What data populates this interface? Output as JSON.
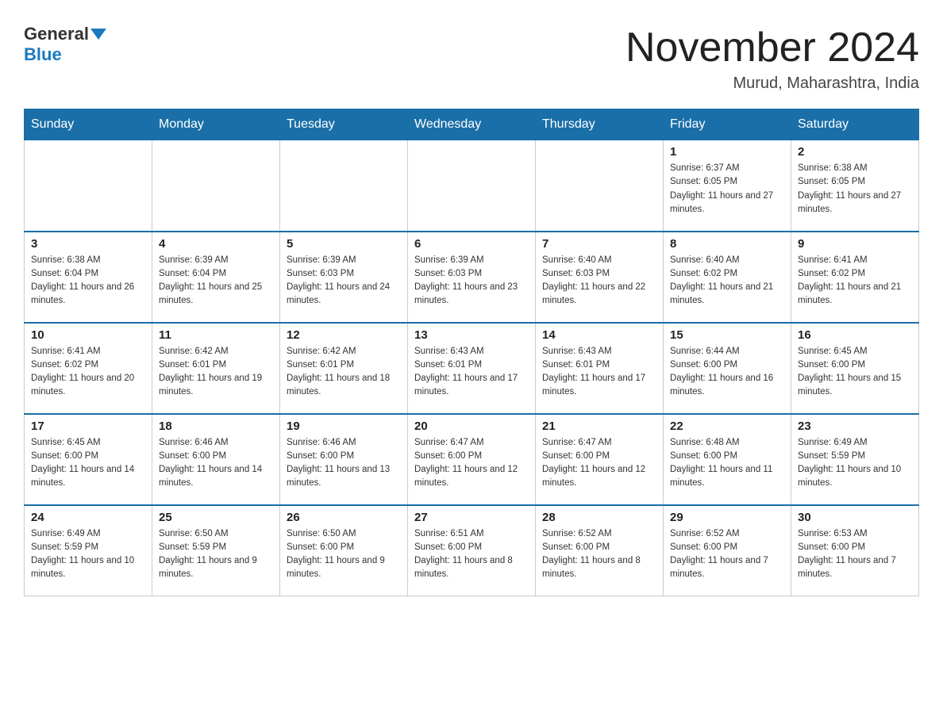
{
  "logo": {
    "general": "General",
    "blue": "Blue"
  },
  "title": "November 2024",
  "location": "Murud, Maharashtra, India",
  "days_of_week": [
    "Sunday",
    "Monday",
    "Tuesday",
    "Wednesday",
    "Thursday",
    "Friday",
    "Saturday"
  ],
  "weeks": [
    [
      {
        "day": "",
        "info": ""
      },
      {
        "day": "",
        "info": ""
      },
      {
        "day": "",
        "info": ""
      },
      {
        "day": "",
        "info": ""
      },
      {
        "day": "",
        "info": ""
      },
      {
        "day": "1",
        "info": "Sunrise: 6:37 AM\nSunset: 6:05 PM\nDaylight: 11 hours and 27 minutes."
      },
      {
        "day": "2",
        "info": "Sunrise: 6:38 AM\nSunset: 6:05 PM\nDaylight: 11 hours and 27 minutes."
      }
    ],
    [
      {
        "day": "3",
        "info": "Sunrise: 6:38 AM\nSunset: 6:04 PM\nDaylight: 11 hours and 26 minutes."
      },
      {
        "day": "4",
        "info": "Sunrise: 6:39 AM\nSunset: 6:04 PM\nDaylight: 11 hours and 25 minutes."
      },
      {
        "day": "5",
        "info": "Sunrise: 6:39 AM\nSunset: 6:03 PM\nDaylight: 11 hours and 24 minutes."
      },
      {
        "day": "6",
        "info": "Sunrise: 6:39 AM\nSunset: 6:03 PM\nDaylight: 11 hours and 23 minutes."
      },
      {
        "day": "7",
        "info": "Sunrise: 6:40 AM\nSunset: 6:03 PM\nDaylight: 11 hours and 22 minutes."
      },
      {
        "day": "8",
        "info": "Sunrise: 6:40 AM\nSunset: 6:02 PM\nDaylight: 11 hours and 21 minutes."
      },
      {
        "day": "9",
        "info": "Sunrise: 6:41 AM\nSunset: 6:02 PM\nDaylight: 11 hours and 21 minutes."
      }
    ],
    [
      {
        "day": "10",
        "info": "Sunrise: 6:41 AM\nSunset: 6:02 PM\nDaylight: 11 hours and 20 minutes."
      },
      {
        "day": "11",
        "info": "Sunrise: 6:42 AM\nSunset: 6:01 PM\nDaylight: 11 hours and 19 minutes."
      },
      {
        "day": "12",
        "info": "Sunrise: 6:42 AM\nSunset: 6:01 PM\nDaylight: 11 hours and 18 minutes."
      },
      {
        "day": "13",
        "info": "Sunrise: 6:43 AM\nSunset: 6:01 PM\nDaylight: 11 hours and 17 minutes."
      },
      {
        "day": "14",
        "info": "Sunrise: 6:43 AM\nSunset: 6:01 PM\nDaylight: 11 hours and 17 minutes."
      },
      {
        "day": "15",
        "info": "Sunrise: 6:44 AM\nSunset: 6:00 PM\nDaylight: 11 hours and 16 minutes."
      },
      {
        "day": "16",
        "info": "Sunrise: 6:45 AM\nSunset: 6:00 PM\nDaylight: 11 hours and 15 minutes."
      }
    ],
    [
      {
        "day": "17",
        "info": "Sunrise: 6:45 AM\nSunset: 6:00 PM\nDaylight: 11 hours and 14 minutes."
      },
      {
        "day": "18",
        "info": "Sunrise: 6:46 AM\nSunset: 6:00 PM\nDaylight: 11 hours and 14 minutes."
      },
      {
        "day": "19",
        "info": "Sunrise: 6:46 AM\nSunset: 6:00 PM\nDaylight: 11 hours and 13 minutes."
      },
      {
        "day": "20",
        "info": "Sunrise: 6:47 AM\nSunset: 6:00 PM\nDaylight: 11 hours and 12 minutes."
      },
      {
        "day": "21",
        "info": "Sunrise: 6:47 AM\nSunset: 6:00 PM\nDaylight: 11 hours and 12 minutes."
      },
      {
        "day": "22",
        "info": "Sunrise: 6:48 AM\nSunset: 6:00 PM\nDaylight: 11 hours and 11 minutes."
      },
      {
        "day": "23",
        "info": "Sunrise: 6:49 AM\nSunset: 5:59 PM\nDaylight: 11 hours and 10 minutes."
      }
    ],
    [
      {
        "day": "24",
        "info": "Sunrise: 6:49 AM\nSunset: 5:59 PM\nDaylight: 11 hours and 10 minutes."
      },
      {
        "day": "25",
        "info": "Sunrise: 6:50 AM\nSunset: 5:59 PM\nDaylight: 11 hours and 9 minutes."
      },
      {
        "day": "26",
        "info": "Sunrise: 6:50 AM\nSunset: 6:00 PM\nDaylight: 11 hours and 9 minutes."
      },
      {
        "day": "27",
        "info": "Sunrise: 6:51 AM\nSunset: 6:00 PM\nDaylight: 11 hours and 8 minutes."
      },
      {
        "day": "28",
        "info": "Sunrise: 6:52 AM\nSunset: 6:00 PM\nDaylight: 11 hours and 8 minutes."
      },
      {
        "day": "29",
        "info": "Sunrise: 6:52 AM\nSunset: 6:00 PM\nDaylight: 11 hours and 7 minutes."
      },
      {
        "day": "30",
        "info": "Sunrise: 6:53 AM\nSunset: 6:00 PM\nDaylight: 11 hours and 7 minutes."
      }
    ]
  ]
}
